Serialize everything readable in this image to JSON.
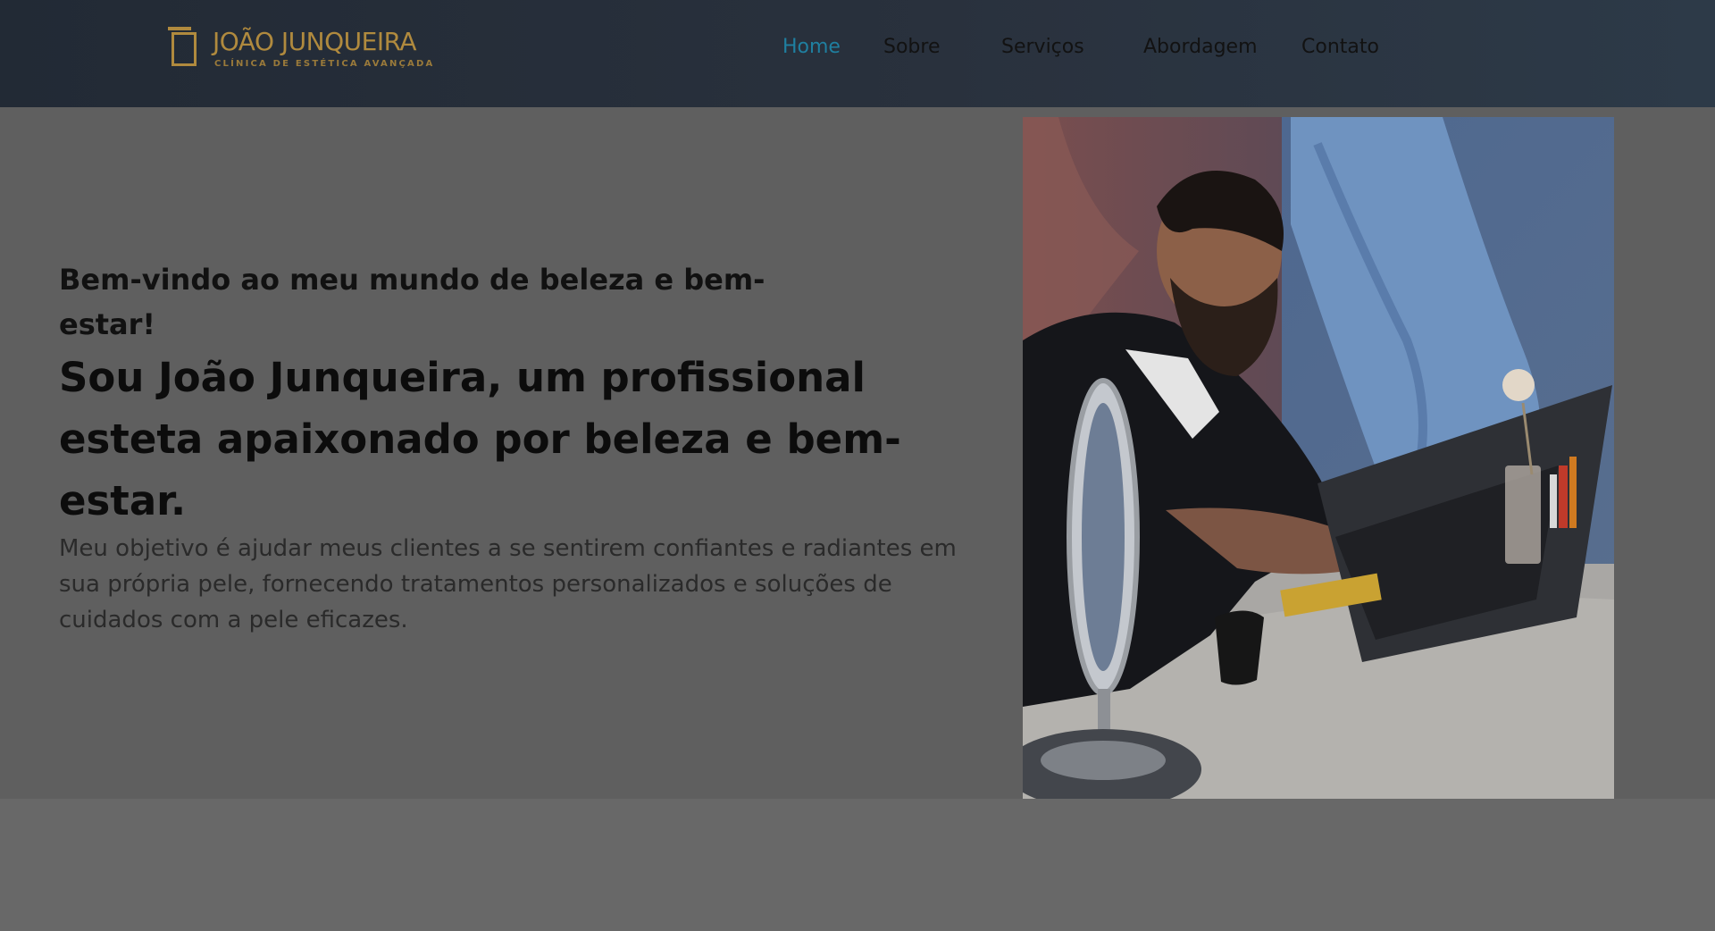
{
  "header": {
    "logo": {
      "name": "JOÃO JUNQUEIRA",
      "tagline": "CLÍNICA DE ESTÉTICA AVANÇADA"
    },
    "nav": [
      {
        "label": "Home",
        "active": true
      },
      {
        "label": "Sobre",
        "active": false
      },
      {
        "label": "Serviços",
        "active": false
      },
      {
        "label": "Abordagem",
        "active": false
      },
      {
        "label": "Contato",
        "active": false
      }
    ]
  },
  "hero": {
    "welcome": "Bem-vindo ao meu mundo de beleza e bem-estar!",
    "headline": "Sou João Junqueira, um profissional esteta apaixonado por beleza e bem-estar.",
    "intro": "Meu objetivo é ajudar meus clientes a se sentirem confiantes e radiantes em sua própria pele, fornecendo tratamentos personalizados e soluções de cuidados com a pele eficazes."
  },
  "colors": {
    "brand_gold": "#b08a3e",
    "nav_active": "#1f7fa0",
    "header_bg": "#252d38",
    "overlay_gray": "#5f5f5f"
  }
}
